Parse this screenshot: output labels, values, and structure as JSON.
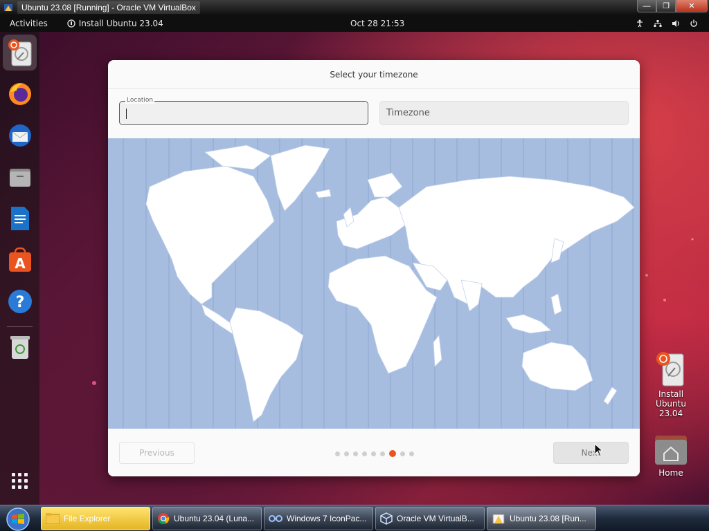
{
  "vbox": {
    "title": "Ubuntu 23.08 [Running] - Oracle VM VirtualBox",
    "controls": {
      "minimize": "—",
      "restore": "❐",
      "close": "✕"
    }
  },
  "topbar": {
    "activities": "Activities",
    "app_menu": "Install Ubuntu 23.04",
    "clock": "Oct 28  21:53"
  },
  "dock": {
    "items": [
      {
        "name": "install-ubuntu",
        "active": true
      },
      {
        "name": "firefox"
      },
      {
        "name": "thunderbird"
      },
      {
        "name": "files"
      },
      {
        "name": "libreoffice-writer"
      },
      {
        "name": "app-center"
      },
      {
        "name": "help"
      },
      {
        "name": "trash"
      },
      {
        "name": "show-apps"
      }
    ]
  },
  "dialog": {
    "title": "Select your timezone",
    "location_label": "Location",
    "location_value": "",
    "timezone_placeholder": "Timezone",
    "previous_label": "Previous",
    "next_label": "Next",
    "steps_total": 9,
    "current_step": 6
  },
  "desktop_icons": {
    "installer_label": "Install Ubuntu\n23.04",
    "installer_line1": "Install Ubuntu",
    "installer_line2": "23.04",
    "home_label": "Home"
  },
  "taskbar": {
    "items": [
      {
        "label": "File Explorer"
      },
      {
        "label": "Ubuntu 23.04 (Luna..."
      },
      {
        "label": "Windows 7 IconPac..."
      },
      {
        "label": "Oracle VM VirtualB..."
      },
      {
        "label": "Ubuntu 23.08 [Run..."
      }
    ]
  },
  "colors": {
    "ubuntu_orange": "#e95420",
    "map_ocean": "#a6bde0",
    "map_land": "#ffffff"
  }
}
